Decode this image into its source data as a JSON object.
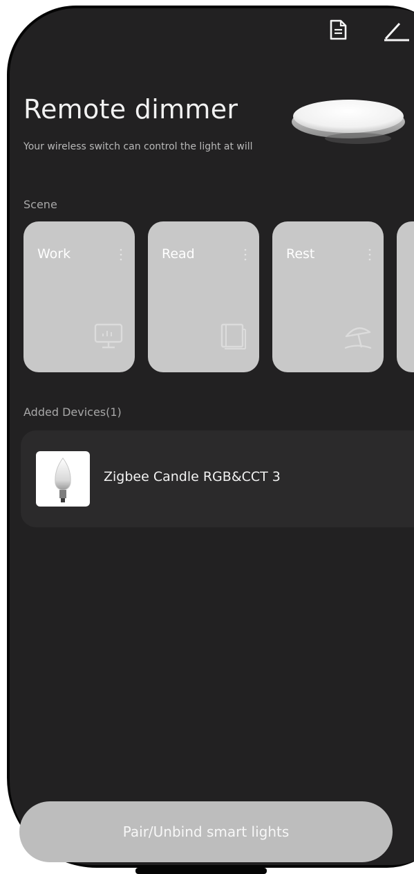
{
  "header": {
    "title": "Remote dimmer",
    "subtitle": "Your wireless switch can control the light at will",
    "doc_icon": "document-icon",
    "edit_icon": "edit-icon"
  },
  "scene": {
    "label": "Scene",
    "cards": [
      {
        "name": "Work",
        "icon": "monitor-icon"
      },
      {
        "name": "Read",
        "icon": "book-icon"
      },
      {
        "name": "Rest",
        "icon": "beach-umbrella-icon"
      }
    ]
  },
  "devices": {
    "label": "Added Devices(1)",
    "items": [
      {
        "name": "Zigbee Candle RGB&CCT 3",
        "icon": "candle-bulb-icon"
      }
    ]
  },
  "footer": {
    "pair_button_label": "Pair/Unbind smart lights"
  },
  "colors": {
    "background": "#222122",
    "card": "#c8c8c8",
    "device_row": "#2b2a2b",
    "button": "#bdbdbd",
    "text_primary": "#f2f2f2",
    "text_secondary": "#a8a8a8"
  }
}
